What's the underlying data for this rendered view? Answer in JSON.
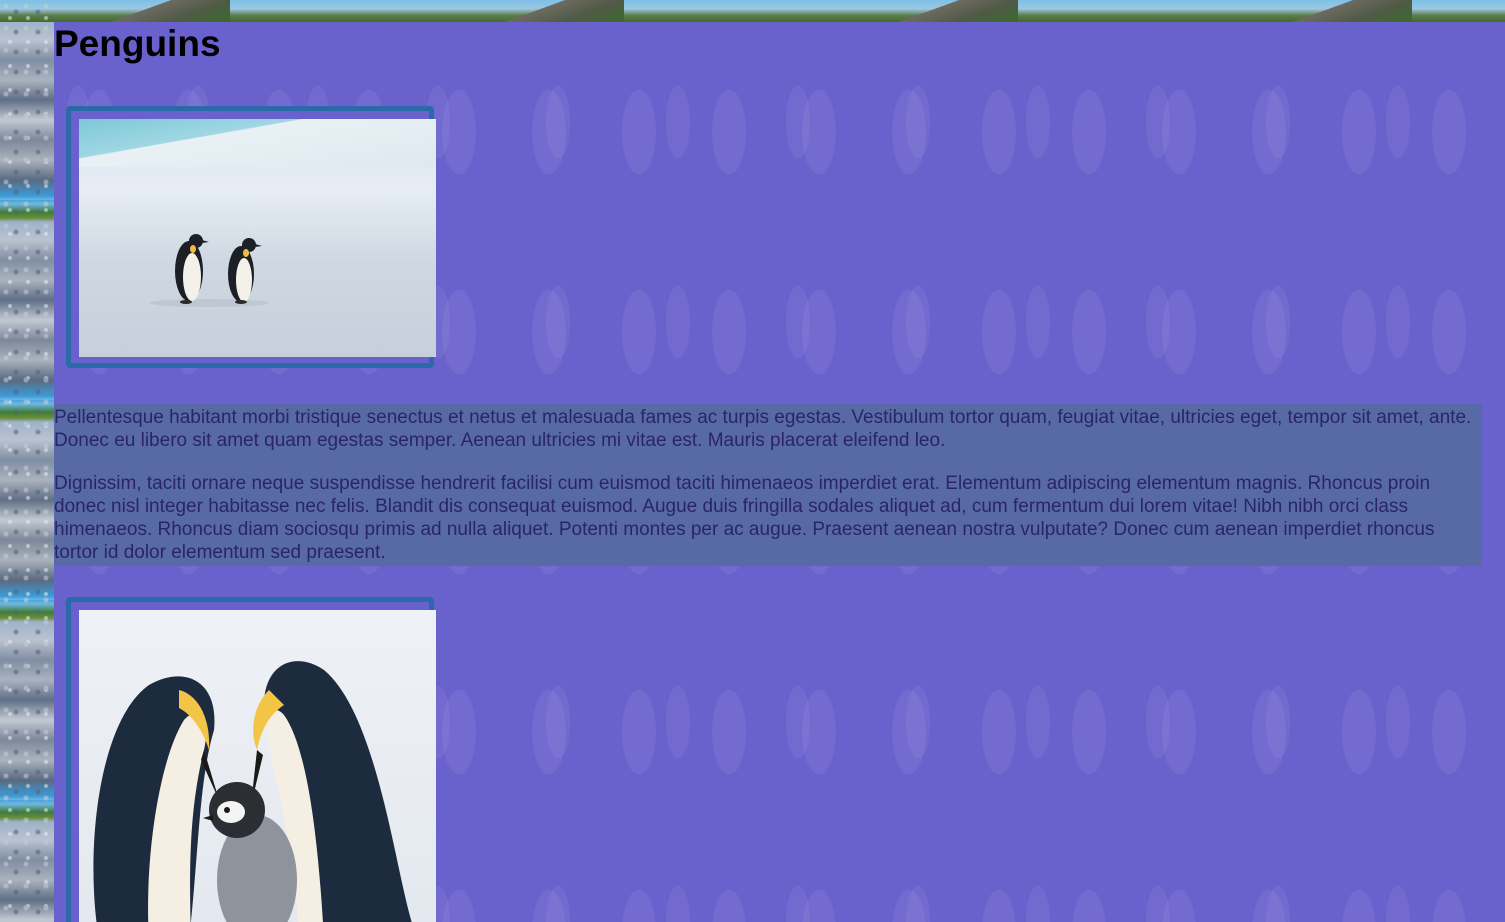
{
  "page": {
    "title": "Penguins"
  },
  "images": [
    {
      "name": "two-emperor-penguins-on-snow",
      "alt": "Two emperor penguins on snow"
    },
    {
      "name": "emperor-penguin-family",
      "alt": "Two adult emperor penguins with a chick"
    }
  ],
  "content": {
    "paragraph_1": "Pellentesque habitant morbi tristique senectus et netus et malesuada fames ac turpis egestas. Vestibulum tortor quam, feugiat vitae, ultricies eget, tempor sit amet, ante. Donec eu libero sit amet quam egestas semper. Aenean ultricies mi vitae est. Mauris placerat eleifend leo.",
    "paragraph_2": "Dignissim, taciti ornare neque suspendisse hendrerit facilisi cum euismod taciti himenaeos imperdiet erat. Elementum adipiscing elementum magnis. Rhoncus proin donec nisl integer habitasse nec felis. Blandit dis consequat euismod. Augue duis fringilla sodales aliquet ad, cum fermentum dui lorem vitae! Nibh nibh orci class himenaeos. Rhoncus diam sociosqu primis ad nulla aliquet. Potenti montes per ac augue. Praesent aenean nostra vulputate? Donec cum aenean imperdiet rhoncus tortor id dolor elementum sed praesent."
  },
  "colors": {
    "main_background": "#6a62cc",
    "text_panel_background": "#586aa6",
    "text_color": "#2a2566",
    "frame_border": "#2a6aa8",
    "heading_color": "#000000"
  }
}
